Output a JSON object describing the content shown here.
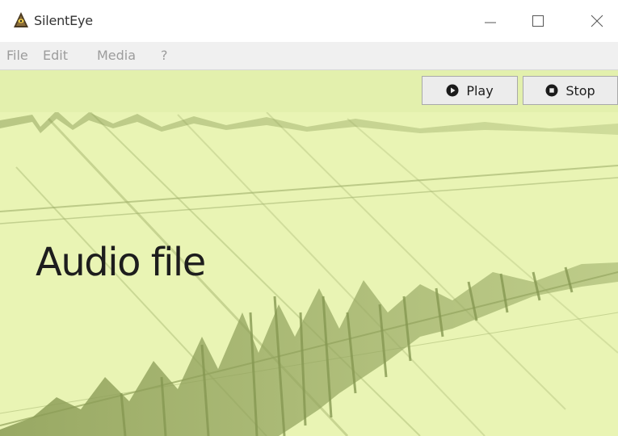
{
  "window": {
    "title": "SilentEye",
    "app_icon": "silenteye-logo-icon",
    "controls": [
      "minimize-icon",
      "maximize-icon",
      "close-icon"
    ]
  },
  "menu": {
    "file": "File",
    "edit": "Edit",
    "media": "Media",
    "help": "?"
  },
  "toolbar": {
    "play_label": "Play",
    "play_icon": "play-icon",
    "stop_label": "Stop",
    "stop_icon": "stop-icon"
  },
  "content": {
    "heading": "Audio file",
    "background": "waveform-image"
  },
  "colors": {
    "canvas_bg": "#e9f4b4",
    "wave": "#8d9e5a",
    "menu_text": "#9c9c9c"
  }
}
